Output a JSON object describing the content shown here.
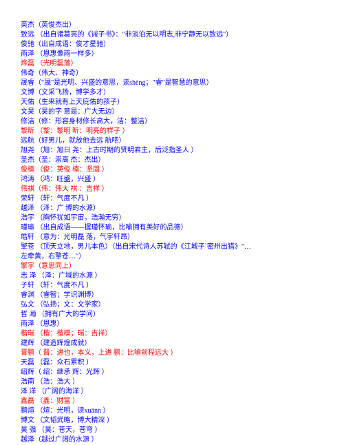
{
  "lines": [
    {
      "text": "英杰（英俊杰出）",
      "red": false
    },
    {
      "text": "致远 （出自诸葛亮的《诫子书》：\"非淡泊无以明志,非宁静无以致远\"）",
      "red": false
    },
    {
      "text": "俊驰（出自成语：俊才星驰）",
      "red": false
    },
    {
      "text": "雨泽 （恩惠像雨一样多）",
      "red": false
    },
    {
      "text": "烨磊 （光明磊落）",
      "red": true
    },
    {
      "text": "伟奇（伟大、神奇）",
      "red": false
    },
    {
      "text": "晟睿（\"晟\"是光明、兴盛的意思，读shèng；\"睿\"是智慧的意思）",
      "red": false
    },
    {
      "text": "文博（文采飞扬，博学多才）",
      "red": false
    },
    {
      "text": "天佑（生来就有上天庇佑的孩子）",
      "red": false
    },
    {
      "text": "文昊（昊的字 意是：广大无边）",
      "red": false
    },
    {
      "text": "修洁（修：形容身材修长高大，洁：整洁）",
      "red": false
    },
    {
      "text": "黎昕 （黎：黎明 昕：明亮的样子 ）",
      "red": true
    },
    {
      "text": "远航（好男儿，就放他去远 航吧）",
      "red": false
    },
    {
      "text": "旭尧 （旭：旭日 尧：上古时期的贤明君主，后泛指圣人 ）",
      "red": false
    },
    {
      "text": "圣杰（圣：崇高 杰：杰出）",
      "red": false
    },
    {
      "text": "俊楠 （俊：英俊 楠：坚固 ）",
      "red": true
    },
    {
      "text": "鸿涛 （鸿：旺盛，兴盛 ）",
      "red": false
    },
    {
      "text": "伟祺（伟：伟大 祺 ：吉祥 ）",
      "red": true
    },
    {
      "text": "荣轩 （轩：气度不凡 ）",
      "red": false
    },
    {
      "text": "越泽 （泽：广 博的水源）",
      "red": false
    },
    {
      "text": "浩宇 （胸怀犹如宇宙，浩瀚无穷）",
      "red": false
    },
    {
      "text": "瑾瑜 （出自成语――握瑾怀瑜，比喻拥有美好的品德）",
      "red": false
    },
    {
      "text": "皓轩 （意为：光明磊 落，气宇轩昂）",
      "red": false
    },
    {
      "text": "擎苍 （顶天立地，男儿本色）（出自宋代诗人苏轼的《江城子`密州出猎》\"…",
      "red": false
    },
    {
      "text": "左牵黄，右擎苍…\"）",
      "red": false
    },
    {
      "text": "擎宇（意思同上）",
      "red": true
    },
    {
      "text": "志 泽 （泽：广域的水源 ）",
      "red": false
    },
    {
      "text": "子轩 （轩：气度不凡 ）",
      "red": false
    },
    {
      "text": "睿渊 （睿智；学识渊博）",
      "red": false
    },
    {
      "text": "弘文 （弘扬；文：文学家）",
      "red": false
    },
    {
      "text": "哲 瀚 （拥有广大的学问）",
      "red": false
    },
    {
      "text": "雨泽 （恩惠）",
      "red": false
    },
    {
      "text": "楷瑞 （楷：楷模；瑞：吉祥）",
      "red": true
    },
    {
      "text": "建辉 （建造辉煌成就）",
      "red": false
    },
    {
      "text": "晋鹏（ 晋：进也，本义，上进 鹏：比喻前程远大 ）",
      "red": true
    },
    {
      "text": "天磊 （磊：众石累积 ）",
      "red": false
    },
    {
      "text": "绍辉（ 绍：继承 辉：光辉 ）",
      "red": false
    },
    {
      "text": "浩南 （浩：浩大 ）",
      "red": false
    },
    {
      "text": "泽 洋 （广阔的海洋 ）",
      "red": false
    },
    {
      "text": "鑫磊 （鑫：财富 ）",
      "red": true
    },
    {
      "text": "鹏煊 （煊：光明，读xuānn ）",
      "red": false
    },
    {
      "text": "博文 （文韬武略，博大精深 ）",
      "red": false
    },
    {
      "text": "昊 强 （昊：苍天，苍穹 ）",
      "red": false
    },
    {
      "text": "越泽（越过广阔的水源 ）",
      "red": false
    }
  ]
}
